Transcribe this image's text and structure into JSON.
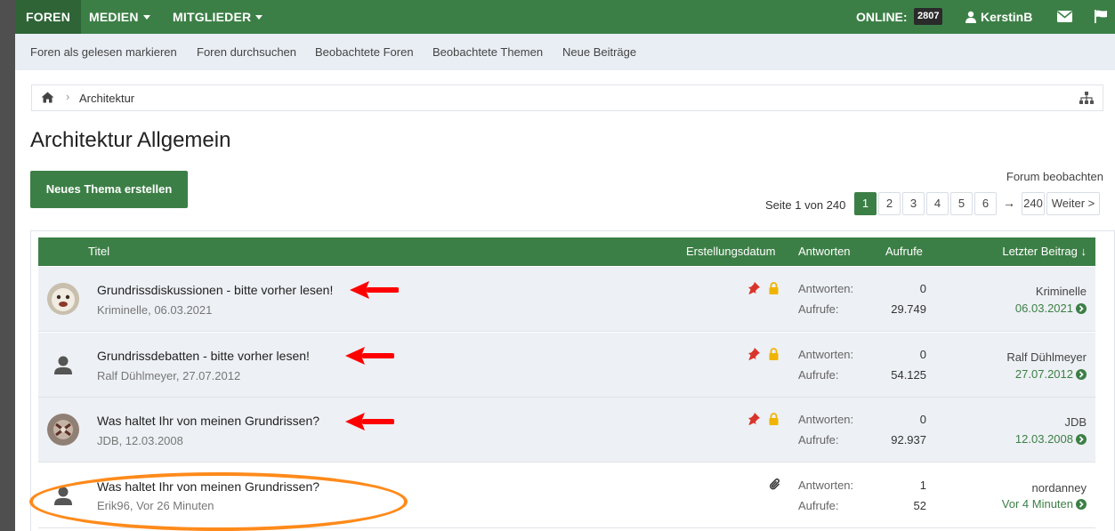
{
  "topnav": {
    "tabs": [
      {
        "label": "FOREN"
      },
      {
        "label": "MEDIEN"
      },
      {
        "label": "MITGLIEDER"
      }
    ],
    "online_label": "ONLINE:",
    "online_count": "2807",
    "username": "KerstinB"
  },
  "subnav": [
    "Foren als gelesen markieren",
    "Foren durchsuchen",
    "Beobachtete Foren",
    "Beobachtete Themen",
    "Neue Beiträge"
  ],
  "breadcrumb": {
    "current": "Architektur"
  },
  "page_title": "Architektur Allgemein",
  "new_thread_label": "Neues Thema erstellen",
  "watch_forum_label": "Forum beobachten",
  "pagination": {
    "label": "Seite 1 von 240",
    "pages": [
      "1",
      "2",
      "3",
      "4",
      "5",
      "6"
    ],
    "arrow": "→",
    "last": "240",
    "next": "Weiter >"
  },
  "table": {
    "headers": {
      "title": "Titel",
      "created": "Erstellungsdatum",
      "replies": "Antworten",
      "views": "Aufrufe",
      "last_post": "Letzter Beitrag ↓"
    },
    "replies_label": "Antworten:",
    "views_label": "Aufrufe:",
    "rows": [
      {
        "title": "Grundrissdiskussionen - bitte vorher lesen!",
        "author": "Kriminelle",
        "date": "06.03.2021",
        "replies": "0",
        "views": "29.749",
        "last_user": "Kriminelle",
        "last_date": "06.03.2021",
        "sticky": true,
        "locked": true
      },
      {
        "title": "Grundrissdebatten - bitte vorher lesen!",
        "author": "Ralf Dühlmeyer",
        "date": "27.07.2012",
        "replies": "0",
        "views": "54.125",
        "last_user": "Ralf Dühlmeyer",
        "last_date": "27.07.2012",
        "sticky": true,
        "locked": true
      },
      {
        "title": "Was haltet Ihr von meinen Grundrissen?",
        "author": "JDB",
        "date": "12.03.2008",
        "replies": "0",
        "views": "92.937",
        "last_user": "JDB",
        "last_date": "12.03.2008",
        "sticky": true,
        "locked": true
      },
      {
        "title": "Was haltet Ihr von meinen Grundrissen?",
        "author": "Erik96",
        "date": "Vor 26 Minuten",
        "replies": "1",
        "views": "52",
        "last_user": "nordanney",
        "last_date": "Vor 4 Minuten",
        "sticky": false,
        "locked": false,
        "attachment": true
      }
    ]
  },
  "colors": {
    "brand": "#3c7f46",
    "brand_dark": "#2e6436",
    "annotation_arrow": "#ff0000",
    "annotation_ellipse": "#ff8a1a"
  }
}
